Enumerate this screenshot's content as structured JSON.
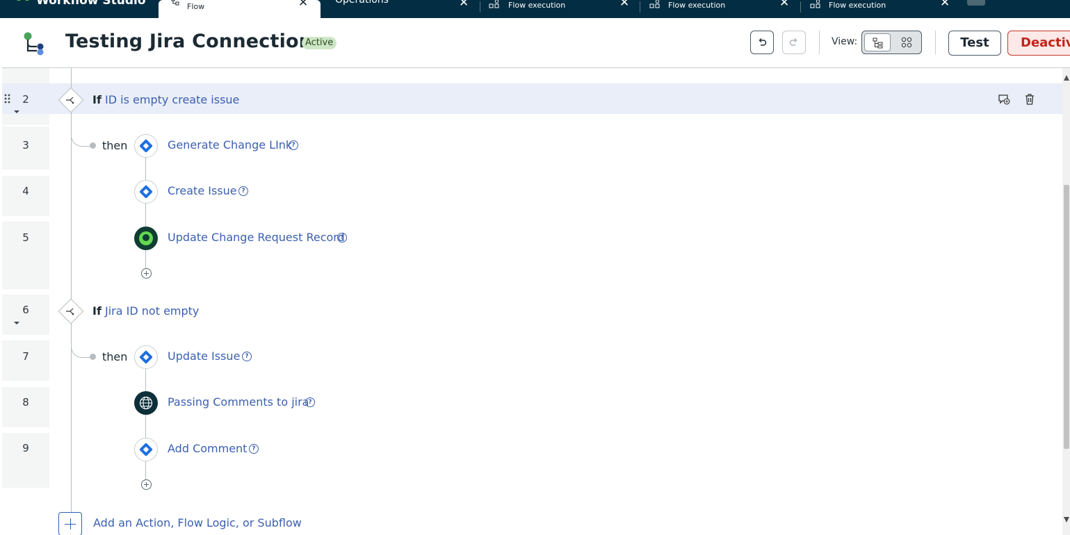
{
  "tabs": {
    "brand": "Workflow Studio",
    "active": {
      "subtitle": "Flow"
    },
    "items": [
      {
        "title": "Operations",
        "subtitle": ""
      },
      {
        "title": "",
        "subtitle": "Flow execution"
      },
      {
        "title": "",
        "subtitle": "Flow execution"
      },
      {
        "title": "",
        "subtitle": "Flow execution"
      }
    ]
  },
  "header": {
    "title": "Testing Jira Connection",
    "status": "Active",
    "view_label": "View:",
    "test_label": "Test",
    "deactivate_label": "Deactivate"
  },
  "flow": {
    "steps": [
      {
        "num": "2",
        "type": "if",
        "keyword": "If",
        "condition": "ID is empty create issue"
      },
      {
        "num": "3",
        "type": "action",
        "then": "then",
        "label": "Generate Change LInk",
        "icon": "jira-icon"
      },
      {
        "num": "4",
        "type": "action",
        "label": "Create Issue",
        "icon": "jira-icon"
      },
      {
        "num": "5",
        "type": "action",
        "label": "Update Change Request Record",
        "icon": "servicenow-icon"
      },
      {
        "num": "6",
        "type": "if",
        "keyword": "If",
        "condition": "Jira ID not empty"
      },
      {
        "num": "7",
        "type": "action",
        "then": "then",
        "label": "Update Issue",
        "icon": "jira-icon"
      },
      {
        "num": "8",
        "type": "action",
        "label": "Passing Comments to jira",
        "icon": "globe-icon"
      },
      {
        "num": "9",
        "type": "action",
        "label": "Add Comment",
        "icon": "jira-icon"
      }
    ],
    "add_label": "Add an Action, Flow Logic, or Subflow"
  },
  "colors": {
    "link": "#3b5fb0",
    "tabbar": "#032d42",
    "status_bg": "#cde6c6",
    "danger": "#c0241a"
  }
}
